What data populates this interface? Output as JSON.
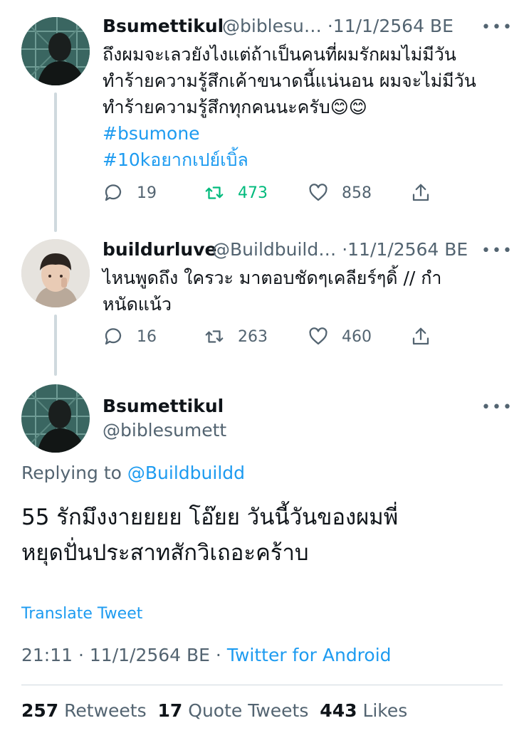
{
  "tweets": [
    {
      "name": "Bsumettikul",
      "handle": "@biblesu…",
      "sep": "·",
      "date": "11/1/2564 BE",
      "lines": [
        "ถึงผมจะเลวยังไงแต่ถ้าเป็นคนที่ผมรักผมไม่มีวัน",
        "ทำร้ายความรู้สึกเค้าขนาดนี้แน่นอน ผมจะไม่มีวัน",
        "ทำร้ายความรู้สึกทุกคนนะครับ😊😊"
      ],
      "hashtags": [
        "#bsumone",
        "#10kอยากเปย์เบิ้ล"
      ],
      "replies": "19",
      "retweets": "473",
      "likes": "858"
    },
    {
      "name": "buildurluve",
      "handle": "@Buildbuild…",
      "sep": "·",
      "date": "11/1/2564 BE",
      "lines": [
        "ไหนพูดถึง ใครวะ มาตอบชัดๆเคลียร์ๆดิ้ // กำ",
        "หนัดแน้ว"
      ],
      "replies": "16",
      "retweets": "263",
      "likes": "460"
    }
  ],
  "main": {
    "name": "Bsumettikul",
    "handle": "@biblesumett",
    "replying_prefix": "Replying to",
    "replying_to": "@Buildbuildd",
    "lines": [
      "55 รักมึงงายยยย โอ๊ยย วันนี้วันของผมพี่",
      "หยุดปั่นประสาทสักวิเถอะคร้าบ"
    ],
    "translate": "Translate Tweet",
    "timestamp": "21:11 · 11/1/2564 BE ·",
    "source": "Twitter for Android",
    "stats": {
      "retweets_count": "257",
      "retweets_label": "Retweets",
      "quotes_count": "17",
      "quotes_label": "Quote Tweets",
      "likes_count": "443",
      "likes_label": "Likes"
    }
  },
  "more_glyph": "•••",
  "colors": {
    "accent": "#1d9bf0",
    "retweet_active": "#00ba7c",
    "muted": "#536471",
    "text": "#0f1419"
  }
}
